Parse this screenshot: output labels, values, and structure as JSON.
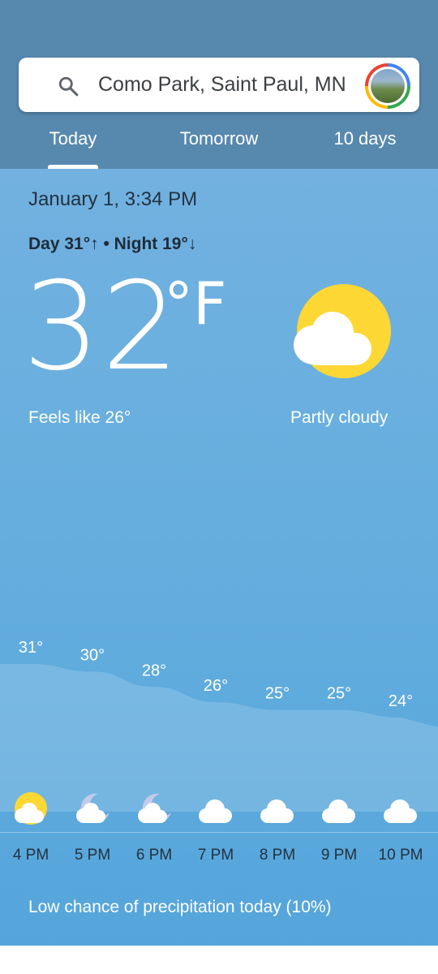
{
  "search": {
    "query": "Como Park, Saint Paul, MN",
    "icon": "search-icon"
  },
  "tabs": [
    {
      "label": "Today",
      "selected": true
    },
    {
      "label": "Tomorrow",
      "selected": false
    },
    {
      "label": "10 days",
      "selected": false
    }
  ],
  "current": {
    "datetime": "January 1, 3:34 PM",
    "day_night": "Day 31°↑ • Night 19°↓",
    "temp": "32",
    "unit": "°F",
    "feels_like": "Feels like 26°",
    "condition": "Partly cloudy",
    "icon": "partly-cloudy-icon"
  },
  "hourly": [
    {
      "time": "4 PM",
      "temp_label": "31°",
      "temp": 31,
      "icon": "partly-cloudy-icon"
    },
    {
      "time": "5 PM",
      "temp_label": "30°",
      "temp": 30,
      "icon": "cloudy-night-icon"
    },
    {
      "time": "6 PM",
      "temp_label": "28°",
      "temp": 28,
      "icon": "cloudy-night-icon"
    },
    {
      "time": "7 PM",
      "temp_label": "26°",
      "temp": 26,
      "icon": "cloud-icon"
    },
    {
      "time": "8 PM",
      "temp_label": "25°",
      "temp": 25,
      "icon": "cloud-icon"
    },
    {
      "time": "9 PM",
      "temp_label": "25°",
      "temp": 25,
      "icon": "cloud-icon"
    },
    {
      "time": "10 PM",
      "temp_label": "24°",
      "temp": 24,
      "icon": "cloud-icon"
    }
  ],
  "precipitation": "Low chance of precipitation today (10%)",
  "colors": {
    "header": "#5789ae",
    "sky": "#64aede",
    "sun": "#fdd835",
    "cloud": "#ffffff"
  }
}
